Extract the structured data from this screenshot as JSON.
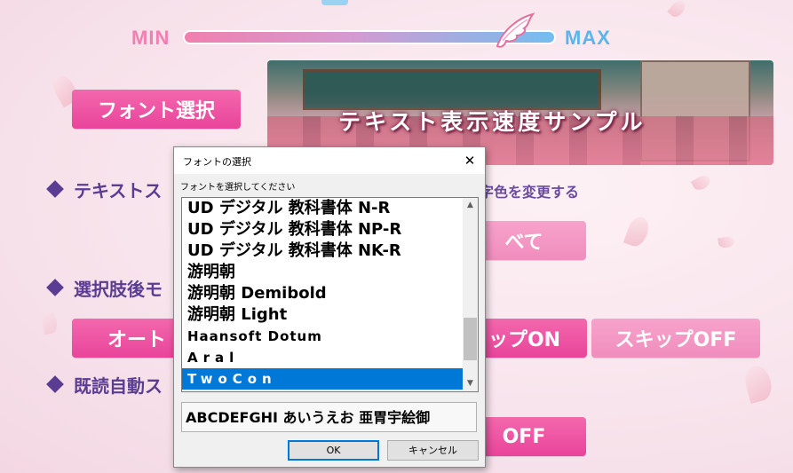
{
  "speed": {
    "min_label": "MIN",
    "max_label": "MAX",
    "level": 0.97
  },
  "font_select_button": "フォント選択",
  "sample_text": "テキスト表示速度サンプル",
  "sections": {
    "text_skip_label": "テキストス",
    "text_skip_note": "字色を変更する",
    "after_choice_label": "選択肢後モ",
    "read_skip_label": "既読自動ス"
  },
  "option_buttons": {
    "all_button": "べて",
    "auto_button": "オート",
    "skip_on_button": "ップON",
    "skip_off_button": "スキップOFF",
    "off_button": "OFF"
  },
  "dialog": {
    "title": "フォントの選択",
    "close_glyph": "✕",
    "prompt": "フォントを選択してください",
    "fonts": [
      "UD デジタル 教科書体 N-R",
      "UD デジタル 教科書体 NP-R",
      "UD デジタル 教科書体 NK-R",
      "游明朝",
      "游明朝 Demibold",
      "游明朝 Light",
      "Haansoft Dotum",
      "Aral",
      "TwoCon"
    ],
    "selected_font": "TwoCon",
    "preview_text": "ABCDEFGHI あいうえお 亜胃宇絵御",
    "ok_label": "OK",
    "cancel_label": "キャンセル"
  },
  "colors": {
    "accent_pink": "#e9449a",
    "accent_purple": "#5a3d93",
    "selection_blue": "#0078d7"
  }
}
